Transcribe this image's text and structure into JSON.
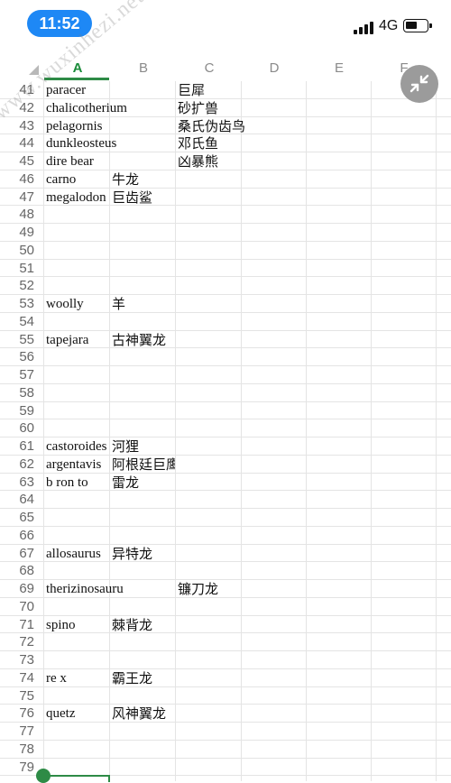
{
  "status_bar": {
    "time": "11:52",
    "network": "4G",
    "signal_level": 4,
    "battery_level": 0.55
  },
  "watermark": "www.wuxinhezi.net",
  "columns": [
    "A",
    "B",
    "C",
    "D",
    "E",
    "F"
  ],
  "active_column": "A",
  "rows": [
    {
      "num": "41",
      "a": "paracer",
      "b": "",
      "c": "巨犀"
    },
    {
      "num": "42",
      "a": "chalicotherium",
      "b": "",
      "c": "砂扩兽"
    },
    {
      "num": "43",
      "a": "pelagornis",
      "b": "",
      "c": "桑氏伪齿鸟"
    },
    {
      "num": "44",
      "a": "dunkleosteus",
      "b": "",
      "c": "邓氏鱼"
    },
    {
      "num": "45",
      "a": "dire bear",
      "b": "",
      "c": "凶暴熊"
    },
    {
      "num": "46",
      "a": "carno",
      "b": "牛龙",
      "c": ""
    },
    {
      "num": "47",
      "a": "megalodon",
      "b": "巨齿鲨",
      "c": ""
    },
    {
      "num": "48",
      "a": "",
      "b": "",
      "c": ""
    },
    {
      "num": "49",
      "a": "",
      "b": "",
      "c": ""
    },
    {
      "num": "50",
      "a": "",
      "b": "",
      "c": ""
    },
    {
      "num": "51",
      "a": "",
      "b": "",
      "c": ""
    },
    {
      "num": "52",
      "a": "",
      "b": "",
      "c": ""
    },
    {
      "num": "53",
      "a": "woolly",
      "b": "羊",
      "c": ""
    },
    {
      "num": "54",
      "a": "",
      "b": "",
      "c": ""
    },
    {
      "num": "55",
      "a": "tapejara",
      "b": "古神翼龙",
      "c": ""
    },
    {
      "num": "56",
      "a": "",
      "b": "",
      "c": ""
    },
    {
      "num": "57",
      "a": "",
      "b": "",
      "c": ""
    },
    {
      "num": "58",
      "a": "",
      "b": "",
      "c": ""
    },
    {
      "num": "59",
      "a": "",
      "b": "",
      "c": ""
    },
    {
      "num": "60",
      "a": "",
      "b": "",
      "c": ""
    },
    {
      "num": "61",
      "a": "castoroides",
      "b": "河狸",
      "c": ""
    },
    {
      "num": "62",
      "a": "argentavis",
      "b": "阿根廷巨鹰",
      "c": ""
    },
    {
      "num": "63",
      "a": "b ron to",
      "b": "雷龙",
      "c": ""
    },
    {
      "num": "64",
      "a": "",
      "b": "",
      "c": ""
    },
    {
      "num": "65",
      "a": "",
      "b": "",
      "c": ""
    },
    {
      "num": "66",
      "a": "",
      "b": "",
      "c": ""
    },
    {
      "num": "67",
      "a": "allosaurus",
      "b": "异特龙",
      "c": ""
    },
    {
      "num": "68",
      "a": "",
      "b": "",
      "c": ""
    },
    {
      "num": "69",
      "a": "therizinosauru",
      "b": "",
      "c": "镰刀龙"
    },
    {
      "num": "70",
      "a": "",
      "b": "",
      "c": ""
    },
    {
      "num": "71",
      "a": "spino",
      "b": "棘背龙",
      "c": ""
    },
    {
      "num": "72",
      "a": "",
      "b": "",
      "c": ""
    },
    {
      "num": "73",
      "a": "",
      "b": "",
      "c": ""
    },
    {
      "num": "74",
      "a": "re x",
      "b": "霸王龙",
      "c": ""
    },
    {
      "num": "75",
      "a": "",
      "b": "",
      "c": ""
    },
    {
      "num": "76",
      "a": "quetz",
      "b": "风神翼龙",
      "c": ""
    },
    {
      "num": "77",
      "a": "",
      "b": "",
      "c": ""
    },
    {
      "num": "78",
      "a": "",
      "b": "",
      "c": ""
    },
    {
      "num": "79",
      "a": "",
      "b": "",
      "c": ""
    }
  ]
}
